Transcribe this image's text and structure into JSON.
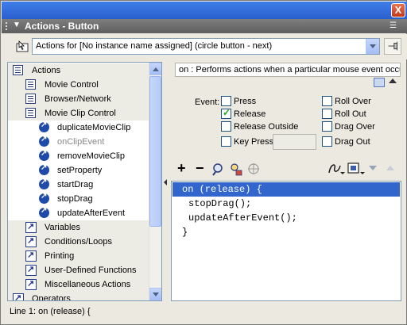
{
  "window": {
    "close_label": "X"
  },
  "panel": {
    "title": "Actions - Button",
    "expand_glyph": "▼",
    "menu_glyph": "☰"
  },
  "target": {
    "text": "Actions for [No instance name assigned] (circle button - next)"
  },
  "tree": {
    "items": [
      {
        "label": "Actions",
        "kind": "book",
        "level": 0
      },
      {
        "label": "Movie Control",
        "kind": "book",
        "level": 1
      },
      {
        "label": "Browser/Network",
        "kind": "book",
        "level": 1
      },
      {
        "label": "Movie Clip Control",
        "kind": "book",
        "level": 1
      },
      {
        "label": "duplicateMovieClip",
        "kind": "action",
        "level": 2
      },
      {
        "label": "onClipEvent",
        "kind": "action-disabled",
        "level": 2
      },
      {
        "label": "removeMovieClip",
        "kind": "action",
        "level": 2
      },
      {
        "label": "setProperty",
        "kind": "action",
        "level": 2
      },
      {
        "label": "startDrag",
        "kind": "action",
        "level": 2
      },
      {
        "label": "stopDrag",
        "kind": "action",
        "level": 2
      },
      {
        "label": "updateAfterEvent",
        "kind": "action",
        "level": 2
      },
      {
        "label": "Variables",
        "kind": "category",
        "level": 1
      },
      {
        "label": "Conditions/Loops",
        "kind": "category",
        "level": 1
      },
      {
        "label": "Printing",
        "kind": "category",
        "level": 1
      },
      {
        "label": "User-Defined Functions",
        "kind": "category",
        "level": 1
      },
      {
        "label": "Miscellaneous Actions",
        "kind": "category",
        "level": 1
      },
      {
        "label": "Operators",
        "kind": "category",
        "level": 0
      }
    ]
  },
  "description": "on : Performs actions when a particular mouse event occurs",
  "event": {
    "label": "Event:",
    "options": [
      {
        "label": "Press",
        "checked": false
      },
      {
        "label": "Roll Over",
        "checked": false
      },
      {
        "label": "Release",
        "checked": true
      },
      {
        "label": "Roll Out",
        "checked": false
      },
      {
        "label": "Release Outside",
        "checked": false
      },
      {
        "label": "Drag Over",
        "checked": false
      },
      {
        "label": "Key Press:",
        "checked": false
      },
      {
        "label": "Drag Out",
        "checked": false
      }
    ],
    "key_press_value": ""
  },
  "toolbar": {
    "add": "+",
    "remove": "−"
  },
  "script": {
    "lines": [
      {
        "text": "on (release) {",
        "selected": true,
        "indent": 0
      },
      {
        "text": "stopDrag();",
        "selected": false,
        "indent": 1
      },
      {
        "text": "updateAfterEvent();",
        "selected": false,
        "indent": 1
      },
      {
        "text": "}",
        "selected": false,
        "indent": 0
      }
    ]
  },
  "status": "Line 1: on (release) {",
  "colors": {
    "title_bar": "#2a5fce",
    "panel_header": "#5e5e5e",
    "selection": "#3366cc",
    "checkmark": "#21a121"
  }
}
